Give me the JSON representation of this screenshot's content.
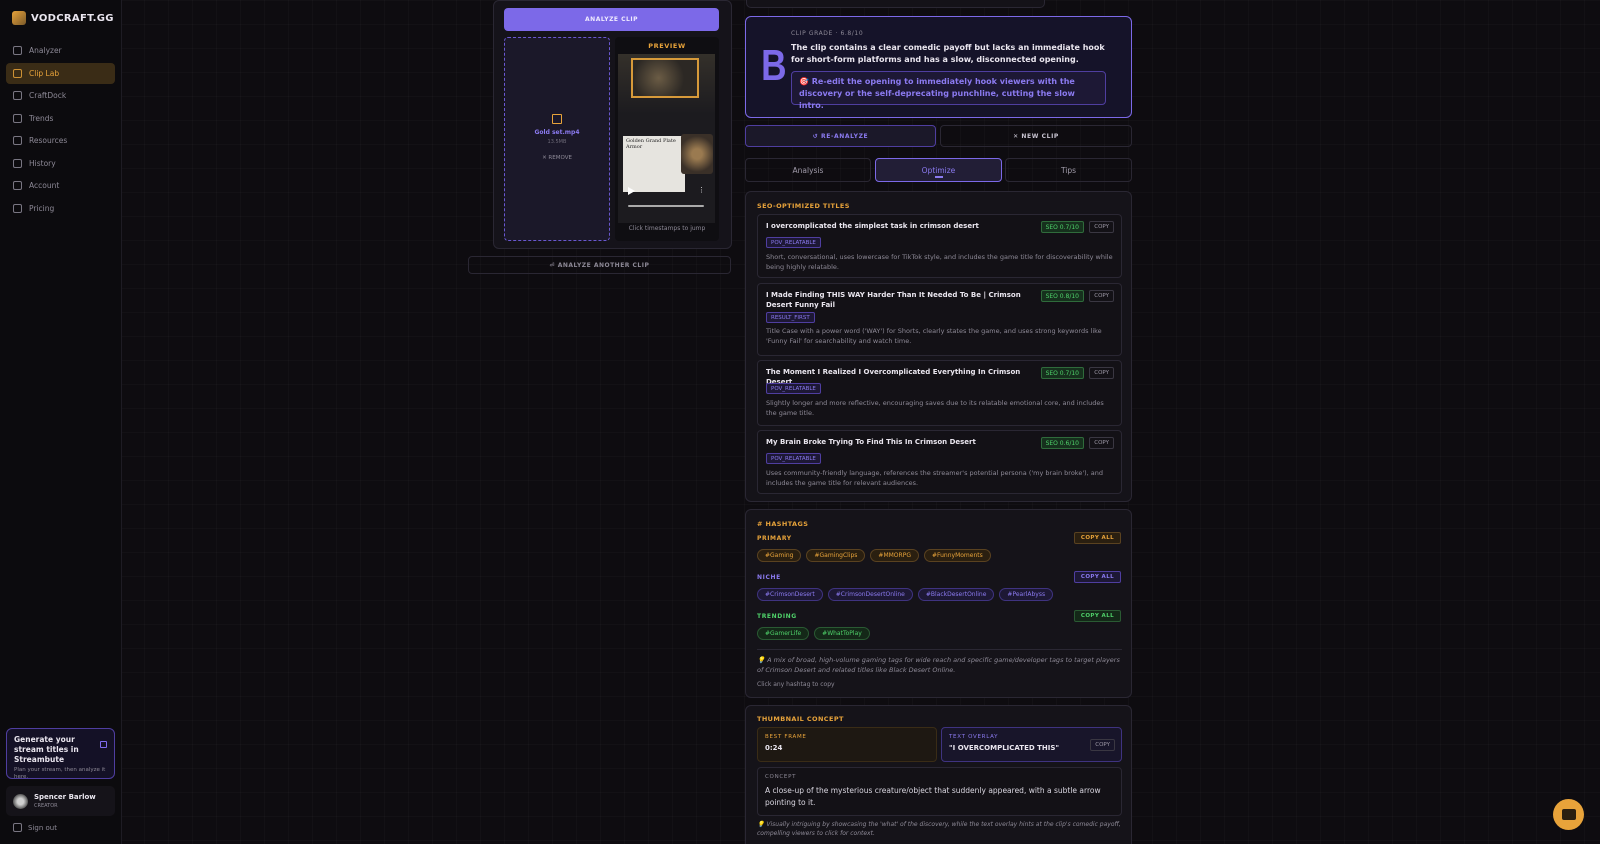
{
  "app": {
    "name": "VODCRAFT.GG"
  },
  "sidebar": {
    "items": [
      {
        "label": "Analyzer",
        "icon": "sparkles-icon",
        "active": false
      },
      {
        "label": "Clip Lab",
        "icon": "flask-icon",
        "active": true
      },
      {
        "label": "CraftDock",
        "icon": "grid-icon",
        "active": false
      },
      {
        "label": "Trends",
        "icon": "trend-icon",
        "active": false
      },
      {
        "label": "Resources",
        "icon": "folder-icon",
        "active": false
      },
      {
        "label": "History",
        "icon": "clock-icon",
        "active": false
      },
      {
        "label": "Account",
        "icon": "user-icon",
        "active": false
      },
      {
        "label": "Pricing",
        "icon": "dollar-icon",
        "active": false
      }
    ],
    "promo": {
      "title": "Generate your stream titles in Streambute",
      "subtitle": "Plan your stream, then analyze it here."
    },
    "user": {
      "name": "Spencer Barlow",
      "role": "CREATOR"
    },
    "signout": "Sign out"
  },
  "clip": {
    "analyze_label": "ANALYZE CLIP",
    "file_name": "Gold set.mp4",
    "file_size": "13.5MB",
    "remove_label": "✕ REMOVE",
    "preview_label": "PREVIEW",
    "preview_footer": "Click timestamps to jump",
    "video_panel_title": "Golden Grand Plate Armor",
    "another_label": "⏎ ANALYZE ANOTHER CLIP"
  },
  "grade": {
    "letter": "B",
    "meta": "CLIP GRADE · 6.8/10",
    "summary": "The clip contains a clear comedic payoff but lacks an immediate hook for short-form platforms and has a slow, disconnected opening.",
    "tip": "🎯 Re-edit the opening to immediately hook viewers with the discovery or the self-deprecating punchline, cutting the slow intro."
  },
  "actions": {
    "reanalyze": "↺ RE-ANALYZE",
    "new_clip": "✕ NEW CLIP"
  },
  "tabs": [
    {
      "label": "Analysis",
      "active": false
    },
    {
      "label": "Optimize",
      "active": true
    },
    {
      "label": "Tips",
      "active": false
    }
  ],
  "seo": {
    "section_title": "SEO-OPTIMIZED TITLES",
    "copy_label": "COPY",
    "titles": [
      {
        "title": "I overcomplicated the simplest task in crimson desert",
        "score": "SEO 0.7/10",
        "tag": "POV_RELATABLE",
        "description": "Short, conversational, uses lowercase for TikTok style, and includes the game title for discoverability while being highly relatable."
      },
      {
        "title": "I Made Finding THIS WAY Harder Than It Needed To Be | Crimson Desert Funny Fail",
        "score": "SEO 0.8/10",
        "tag": "RESULT_FIRST",
        "description": "Title Case with a power word ('WAY') for Shorts, clearly states the game, and uses strong keywords like 'Funny Fail' for searchability and watch time."
      },
      {
        "title": "The Moment I Realized I Overcomplicated Everything In Crimson Desert",
        "score": "SEO 0.7/10",
        "tag": "POV_RELATABLE",
        "description": "Slightly longer and more reflective, encouraging saves due to its relatable emotional core, and includes the game title."
      },
      {
        "title": "My Brain Broke Trying To Find This In Crimson Desert",
        "score": "SEO 0.6/10",
        "tag": "POV_RELATABLE",
        "description": "Uses community-friendly language, references the streamer's potential persona ('my brain broke'), and includes the game title for relevant audiences."
      }
    ]
  },
  "hashtags": {
    "section_title": "# HASHTAGS",
    "copy_all": "COPY ALL",
    "primary_label": "PRIMARY",
    "primary": [
      "#Gaming",
      "#GamingClips",
      "#MMORPG",
      "#FunnyMoments"
    ],
    "niche_label": "NICHE",
    "niche": [
      "#CrimsonDesert",
      "#CrimsonDesertOnline",
      "#BlackDesertOnline",
      "#PearlAbyss"
    ],
    "trending_label": "TRENDING",
    "trending": [
      "#GamerLife",
      "#WhatToPlay"
    ],
    "note": "💡 A mix of broad, high-volume gaming tags for wide reach and specific game/developer tags to target players of Crimson Desert and related titles like Black Desert Online.",
    "hint": "Click any hashtag to copy"
  },
  "thumbnail": {
    "section_title": "THUMBNAIL CONCEPT",
    "best_frame_label": "BEST FRAME",
    "best_frame": "0:24",
    "overlay_label": "TEXT OVERLAY",
    "overlay": "\"I OVERCOMPLICATED THIS\"",
    "copy_label": "COPY",
    "concept_label": "CONCEPT",
    "concept": "A close-up of the mysterious creature/object that suddenly appeared, with a subtle arrow pointing to it.",
    "note": "💡 Visually intriguing by showcasing the 'what' of the discovery, while the text overlay hints at the clip's comedic payoff, compelling viewers to click for context."
  },
  "colors": {
    "accent_purple": "#7c69e8",
    "accent_gold": "#e8a33a",
    "seo_green": "#4fd16a"
  }
}
